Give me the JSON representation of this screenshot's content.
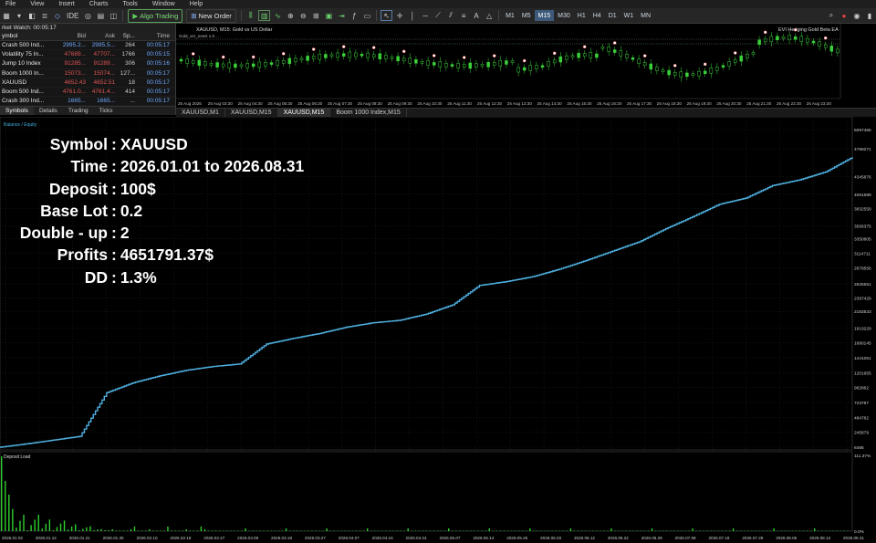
{
  "menu": [
    "File",
    "View",
    "Insert",
    "Charts",
    "Tools",
    "Window",
    "Help"
  ],
  "toolbar": {
    "ide": "IDE",
    "algo_trading": "Algo Trading",
    "new_order": "New Order",
    "timeframes": [
      "M1",
      "M5",
      "M15",
      "M30",
      "H1",
      "H4",
      "D1",
      "W1",
      "MN"
    ],
    "active_timeframe": "M15"
  },
  "market_watch": {
    "title": "rket Watch: 00:05:17",
    "headers": [
      "ymbol",
      "Bid",
      "Ask",
      "Sp...",
      "Time"
    ],
    "rows": [
      {
        "symbol": "Crash 500 Ind...",
        "bid": "2995.2...",
        "ask": "2995.5...",
        "spread": "264",
        "time": "00:05:17",
        "color": "#6fa8ff"
      },
      {
        "symbol": "Volatility 75 In...",
        "bid": "47689...",
        "ask": "47707...",
        "spread": "1766",
        "time": "00:05:15",
        "color": "#e05555"
      },
      {
        "symbol": "Jump 10 Index",
        "bid": "91285...",
        "ask": "91289...",
        "spread": "306",
        "time": "00:05:16",
        "color": "#e05555"
      },
      {
        "symbol": "Boom 1000 In...",
        "bid": "15073...",
        "ask": "15074...",
        "spread": "127...",
        "time": "00:05:17",
        "color": "#e05555"
      },
      {
        "symbol": "XAUUSD",
        "bid": "4652.43",
        "ask": "4652.51",
        "spread": "18",
        "time": "00:05:17",
        "color": "#e05555"
      },
      {
        "symbol": "Boom 500 Ind...",
        "bid": "4761.0...",
        "ask": "4761.4...",
        "spread": "414",
        "time": "00:05:17",
        "color": "#e05555"
      },
      {
        "symbol": "Crash 300 Ind...",
        "bid": "1665...",
        "ask": "1665...",
        "spread": "...",
        "time": "00:05:17",
        "color": "#6fa8ff"
      }
    ],
    "tabs": [
      "Symbols",
      "Details",
      "Trading",
      "Ticks"
    ]
  },
  "mini_chart": {
    "title": "XAUUSD, M15: Gold vs US Dollar",
    "info": "Gold_ver_new2 1.0 ...",
    "right_label": "EVI Hedging Gold Beta EA",
    "time_labels": [
      "25 Aug 2026",
      "25 Aug 03:30",
      "25 Aug 04:30",
      "25 Aug 05:30",
      "25 Aug 06:30",
      "25 Aug 07:30",
      "25 Aug 08:30",
      "25 Aug 09:30",
      "25 Aug 10:30",
      "25 Aug 11:30",
      "25 Aug 12:30",
      "25 Aug 13:30",
      "25 Aug 14:30",
      "25 Aug 15:30",
      "25 Aug 16:30",
      "25 Aug 17:30",
      "25 Aug 18:30",
      "25 Aug 19:30",
      "25 Aug 20:30",
      "25 Aug 21:30",
      "25 Aug 22:30",
      "25 Aug 23:30"
    ]
  },
  "chart_tabs": [
    "XAUUSD,M1",
    "XAUUSD,M15",
    "XAUUSD,M15",
    "Boom 1000 Index,M15"
  ],
  "active_chart_tab": 2,
  "report": {
    "legend": "Balance / Equity",
    "deposit_load_label": "Deposit Load",
    "stats": [
      {
        "label": "Symbol",
        "value": "XAUUSD"
      },
      {
        "label": "Time",
        "value": "2026.01.01 to 2026.08.31"
      },
      {
        "label": "Deposit",
        "value": "100$"
      },
      {
        "label": "Base Lot",
        "value": "0.2"
      },
      {
        "label": "Double - up",
        "value": "2"
      },
      {
        "label": "Profits",
        "value": "4651791.37$"
      },
      {
        "label": "DD",
        "value": "1.3%"
      }
    ],
    "colors": {
      "balance_line": "#4fb0e0",
      "load_bars": "#2fcf2f",
      "grid": "#1f3a1f",
      "text": "#ffffff"
    }
  },
  "chart_data": [
    {
      "type": "line",
      "title": "Balance / Equity",
      "x": [
        "2026.01.02",
        "2026.01.12",
        "2026.01.21",
        "2026.01.30",
        "2026.02.10",
        "2026.02.18",
        "2026.02.27",
        "2026.03.09",
        "2026.03.18",
        "2026.03.27",
        "2026.04.07",
        "2026.04.16",
        "2026.04.24",
        "2026.05.07",
        "2026.05.14",
        "2026.05.25",
        "2026.06.03",
        "2026.06.12",
        "2026.06.22",
        "2026.06.29",
        "2026.07.08",
        "2026.07.18",
        "2026.07.29",
        "2026.08.06",
        "2026.08.13",
        "2026.08.31"
      ],
      "y_ticks": [
        "5097465",
        "4789271",
        "4345876",
        "4061688",
        "3832559",
        "3556375",
        "3350805",
        "3114711",
        "2879556",
        "2626551",
        "2397429",
        "2183533",
        "1919229",
        "1680145",
        "1441051",
        "1201955",
        "962862",
        "723787",
        "484782",
        "245879",
        "6485"
      ],
      "series": [
        {
          "values": [
            6485,
            60000,
            120000,
            180000,
            880000,
            1040000,
            1150000,
            1240000,
            1300000,
            1340000,
            1660000,
            1750000,
            1830000,
            1930000,
            2000000,
            2040000,
            2140000,
            2290000,
            2600000,
            2660000,
            2740000,
            2860000,
            3000000,
            3150000,
            3300000,
            3510000,
            3700000,
            3900000,
            4000000,
            4200000,
            4290000,
            4420000,
            4655000
          ]
        }
      ]
    },
    {
      "type": "bar",
      "title": "Deposit Load",
      "y_ticks": [
        "111.37%",
        "0.0%"
      ],
      "note": "Deposit load spikes concentrated at the start, near zero afterwards"
    }
  ]
}
